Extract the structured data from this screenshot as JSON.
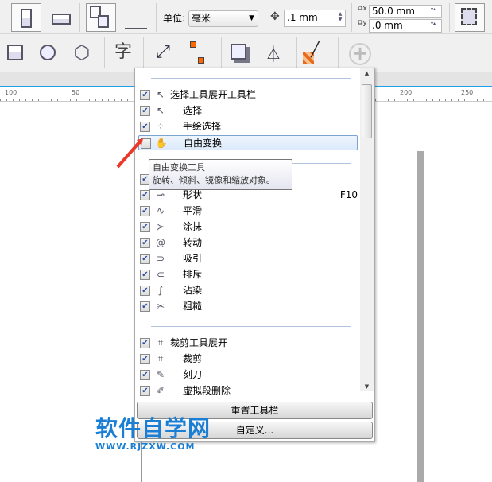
{
  "toolbar1": {
    "unit_label": "单位:",
    "unit_value": "毫米",
    "nudge_value": ".1 mm",
    "dup_x": "50.0 mm",
    "dup_y": ".0 mm"
  },
  "toolbar2": {
    "icons": [
      "rectangle-icon",
      "ellipse-icon",
      "polygon-icon",
      "text-icon",
      "dimension-icon",
      "connector-icon",
      "drop-shadow-icon",
      "transparency-icon",
      "eyedropper-icon",
      "add-icon"
    ],
    "text_glyph": "字"
  },
  "ruler": {
    "ticks": [
      "100",
      "50",
      "200",
      "250"
    ]
  },
  "popup": {
    "items": [
      {
        "label": "选择工具展开工具栏",
        "checked": true,
        "top": true,
        "icon": "pointer-icon"
      },
      {
        "label": "选择",
        "checked": true,
        "icon": "pointer-icon"
      },
      {
        "label": "手绘选择",
        "checked": true,
        "icon": "freehand-pick-icon"
      },
      {
        "label": "自由变换",
        "checked": false,
        "icon": "free-transform-icon",
        "highlighted": true
      }
    ],
    "items2": [
      {
        "label": "",
        "checked": true,
        "icon": "shape-flyout-icon"
      },
      {
        "label": "形状",
        "checked": true,
        "icon": "shape-icon",
        "key": "F10"
      },
      {
        "label": "平滑",
        "checked": true,
        "icon": "smooth-icon"
      },
      {
        "label": "涂抹",
        "checked": true,
        "icon": "smear-icon"
      },
      {
        "label": "转动",
        "checked": true,
        "icon": "twirl-icon"
      },
      {
        "label": "吸引",
        "checked": true,
        "icon": "attract-icon"
      },
      {
        "label": "排斥",
        "checked": true,
        "icon": "repel-icon"
      },
      {
        "label": "沾染",
        "checked": true,
        "icon": "smudge-icon"
      },
      {
        "label": "粗糙",
        "checked": true,
        "icon": "roughen-icon"
      }
    ],
    "items3": [
      {
        "label": "裁剪工具展开",
        "checked": true,
        "top": true,
        "icon": "crop-icon"
      },
      {
        "label": "裁剪",
        "checked": true,
        "icon": "crop-icon"
      },
      {
        "label": "刻刀",
        "checked": true,
        "icon": "knife-icon"
      },
      {
        "label": "虚拟段删除",
        "checked": true,
        "icon": "virtual-segment-delete-icon"
      }
    ],
    "reset_label": "重置工具栏",
    "customize_label": "自定义..."
  },
  "tooltip": {
    "title": "自由变换工具",
    "desc": "旋转、倾斜、镜像和缩放对象。"
  },
  "watermark": {
    "title": "软件自学网",
    "url": "WWW.RJZXW.COM"
  },
  "colors": {
    "accent": "#1ea0e8",
    "watermark": "#1a7fd4",
    "arrow": "#e8392a"
  }
}
